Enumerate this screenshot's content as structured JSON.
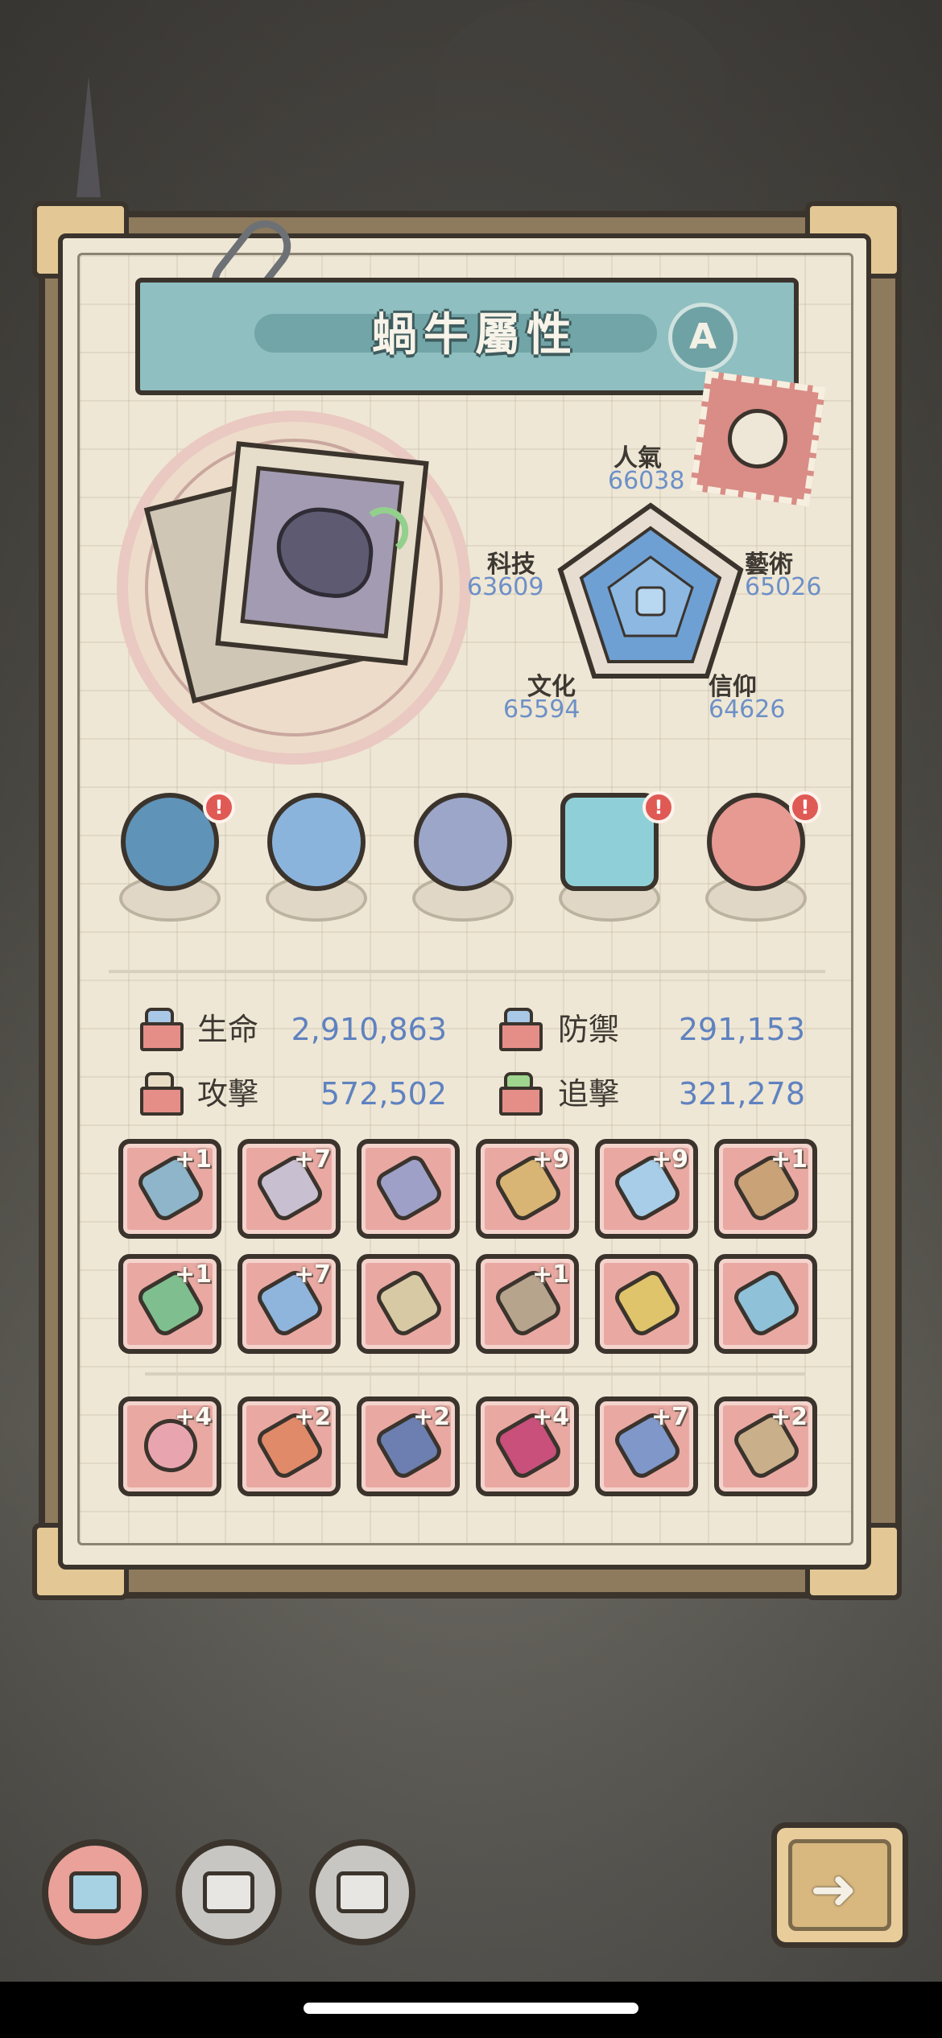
{
  "panel": {
    "title": "蝸牛屬性",
    "a_button": "A"
  },
  "radar_stats": {
    "popularity": {
      "label": "人氣",
      "value": "66038"
    },
    "arts": {
      "label": "藝術",
      "value": "65026"
    },
    "faith": {
      "label": "信仰",
      "value": "64626"
    },
    "culture": {
      "label": "文化",
      "value": "65594"
    },
    "tech": {
      "label": "科技",
      "value": "63609"
    }
  },
  "badges": [
    {
      "icon": "monster-badge-icon",
      "alert": "!"
    },
    {
      "icon": "moon-orb-badge-icon",
      "alert": ""
    },
    {
      "icon": "compass-badge-icon",
      "alert": ""
    },
    {
      "icon": "eye-rune-badge-icon",
      "alert": "!"
    },
    {
      "icon": "red-orb-badge-icon",
      "alert": "!"
    }
  ],
  "attributes": {
    "hp": {
      "label": "生命",
      "value": "2,910,863"
    },
    "defense": {
      "label": "防禦",
      "value": "291,153"
    },
    "attack": {
      "label": "攻擊",
      "value": "572,502"
    },
    "chase": {
      "label": "追擊",
      "value": "321,278"
    }
  },
  "equipment_row1": [
    {
      "icon": "ring-icon",
      "level": "+1"
    },
    {
      "icon": "tentacle-icon",
      "level": "+7"
    },
    {
      "icon": "crystal-icon",
      "level": ""
    },
    {
      "icon": "crossbow-icon",
      "level": "+9"
    },
    {
      "icon": "potion-sword-icon",
      "level": "+9"
    },
    {
      "icon": "gem-amulet-icon",
      "level": "+1"
    }
  ],
  "equipment_row2": [
    {
      "icon": "trident-icon",
      "level": "+1"
    },
    {
      "icon": "blue-sword-icon",
      "level": "+7"
    },
    {
      "icon": "skull-staff-icon",
      "level": ""
    },
    {
      "icon": "spiked-club-icon",
      "level": "+1"
    },
    {
      "icon": "gold-ring-icon",
      "level": ""
    },
    {
      "icon": "dagger-icon",
      "level": ""
    }
  ],
  "equipment_row3": [
    {
      "icon": "mandala-icon",
      "level": "+4"
    },
    {
      "icon": "axe-icon",
      "level": "+2"
    },
    {
      "icon": "helmet-icon",
      "level": "+2"
    },
    {
      "icon": "boot-icon",
      "level": "+4"
    },
    {
      "icon": "gauntlet-icon",
      "level": "+7"
    },
    {
      "icon": "spear-icon",
      "level": "+2"
    }
  ],
  "bottom_tabs": [
    {
      "icon": "screen-tab-icon-1",
      "active": true
    },
    {
      "icon": "screen-tab-icon-2",
      "active": false
    },
    {
      "icon": "screen-tab-icon-3",
      "active": false
    }
  ],
  "next_button": {
    "icon": "arrow-right-icon",
    "glyph": "➜"
  },
  "colors": {
    "paper": "#efe7d5",
    "banner": "#8fbfc0",
    "slot": "#e9a9a2",
    "value_blue": "#5f82c0",
    "outline": "#3b342d"
  }
}
